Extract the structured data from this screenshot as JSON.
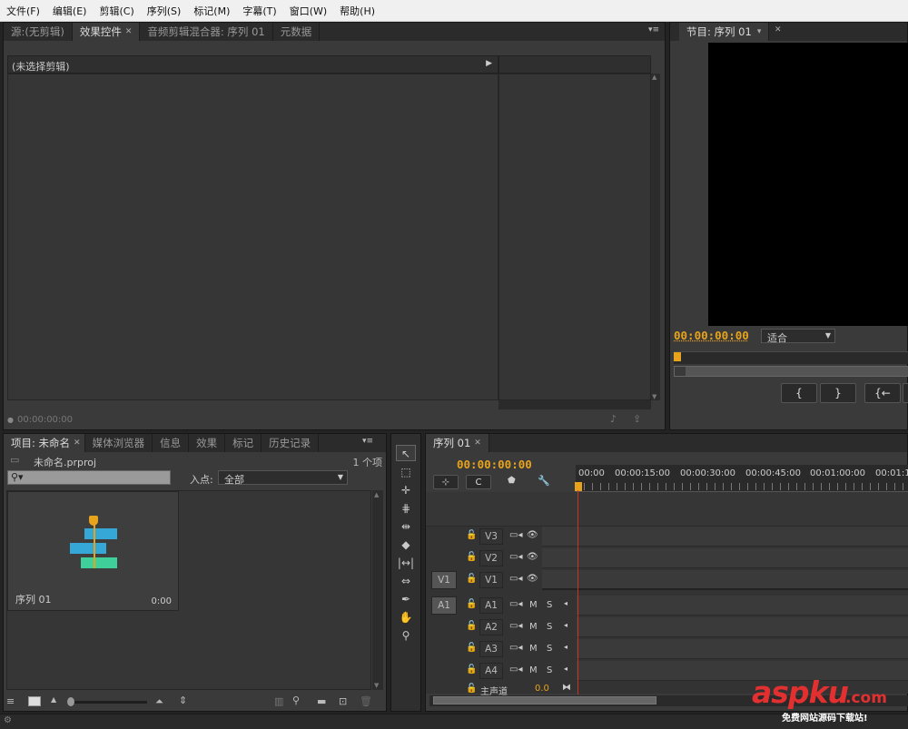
{
  "menu": [
    "文件(F)",
    "编辑(E)",
    "剪辑(C)",
    "序列(S)",
    "标记(M)",
    "字幕(T)",
    "窗口(W)",
    "帮助(H)"
  ],
  "source_panel": {
    "tabs": [
      "源:(无剪辑)",
      "效果控件",
      "音频剪辑混合器: 序列 01",
      "元数据"
    ],
    "no_clip": "(未选择剪辑)",
    "bottom_time": "00:00:00:00"
  },
  "program": {
    "tab": "节目: 序列 01",
    "timecode": "00:00:00:00",
    "fit": "适合"
  },
  "project": {
    "tabs": [
      "项目: 未命名",
      "媒体浏览器",
      "信息",
      "效果",
      "标记",
      "历史记录"
    ],
    "filename": "未命名.prproj",
    "count": "1 个项",
    "inpoint_label": "入点:",
    "inpoint_value": "全部",
    "item_name": "序列 01",
    "item_duration": "0:00"
  },
  "timeline": {
    "tab": "序列 01",
    "timecode": "00:00:00:00",
    "ruler": [
      "00:00",
      "00:00:15:00",
      "00:00:30:00",
      "00:00:45:00",
      "00:01:00:00",
      "00:01:1"
    ],
    "video_tracks": [
      "V3",
      "V2",
      "V1"
    ],
    "audio_tracks": [
      "A1",
      "A2",
      "A3",
      "A4"
    ],
    "src_v": "V1",
    "src_a": "A1",
    "master": "主声道",
    "master_val": "0.0",
    "m": "M",
    "s": "S"
  },
  "watermark": {
    "brand": "aspku",
    "tld": ".com",
    "slogan": "免费网站源码下载站!"
  },
  "colors": {
    "timecode": "#e8a31c",
    "playhead": "#d03020",
    "thumb_blue": "#35a8d8",
    "thumb_green": "#3fcf9a"
  }
}
